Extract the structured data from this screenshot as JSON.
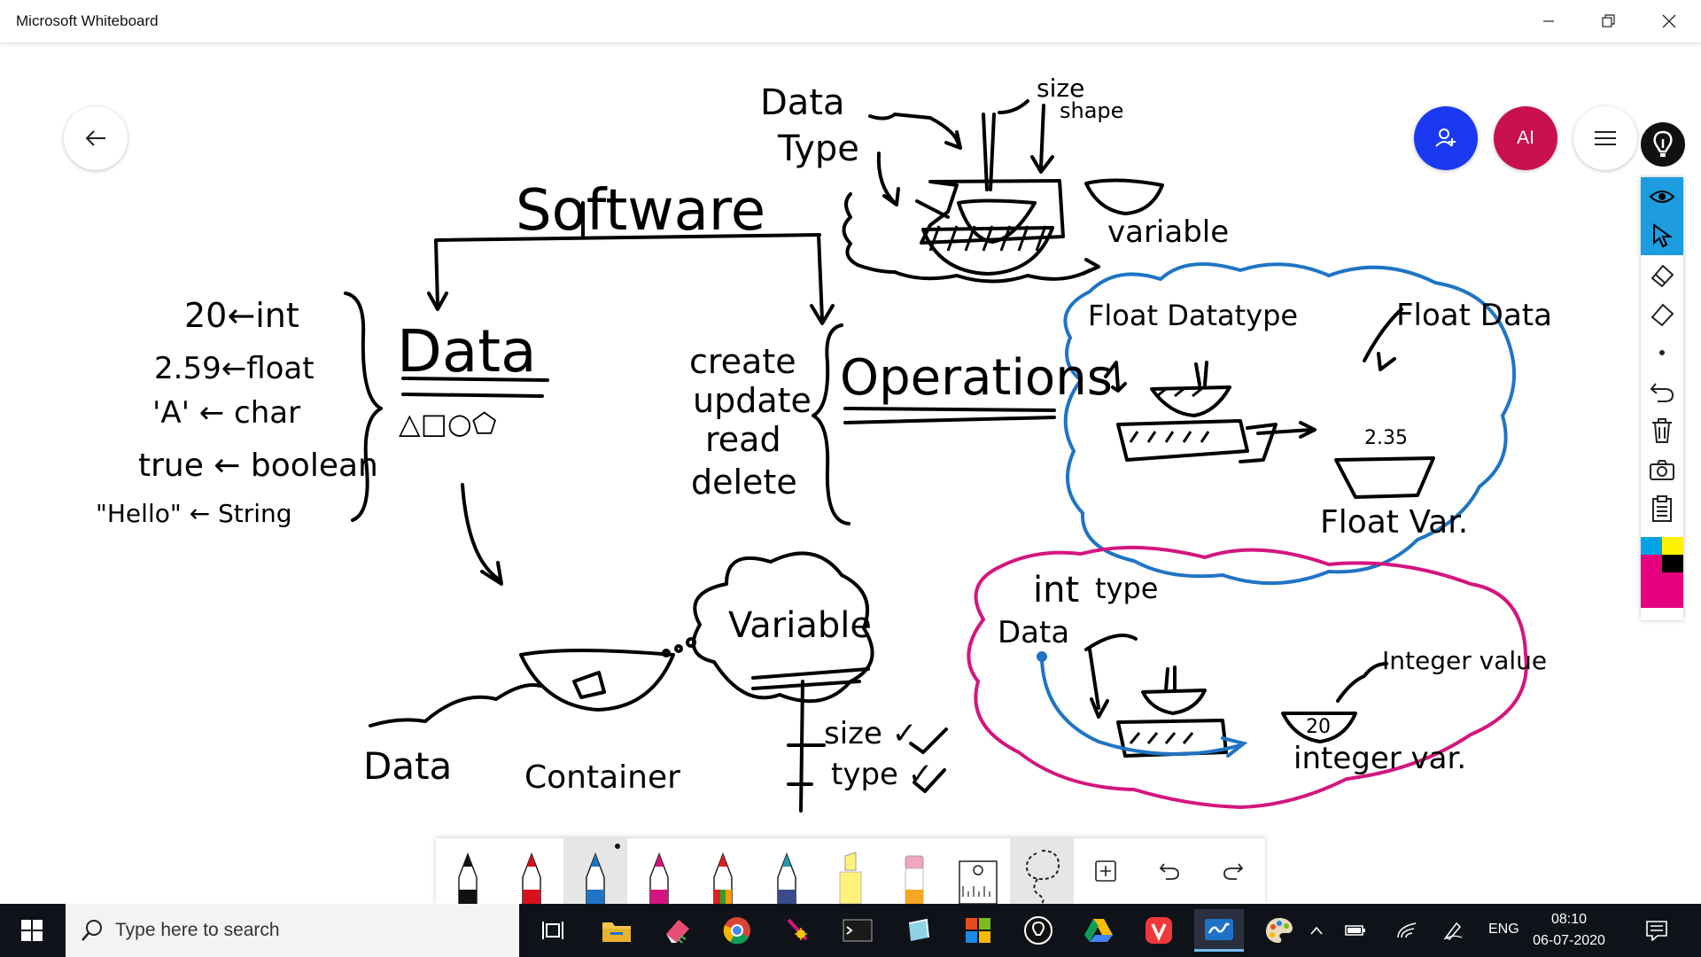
{
  "window": {
    "title": "Microsoft Whiteboard"
  },
  "header": {
    "avatar_initials": "AI"
  },
  "board": {
    "software": "Software",
    "data_heading": "Data",
    "data_shapes": "△□○⬠",
    "ops_heading": "Operations",
    "crud": [
      "create",
      "update",
      "read",
      "delete"
    ],
    "examples": [
      "20←int",
      "2.59←float",
      "'A' ← char",
      "true ← boolean",
      "\"Hello\" ← String"
    ],
    "dt_data": "Data",
    "dt_type": "Type",
    "size_word": "size",
    "shape_word": "shape",
    "variable_word": "variable",
    "float_datatype": "Float Datatype",
    "float_data": "Float Data",
    "float_value": "2.35",
    "float_var": "Float Var.",
    "int_word": "int",
    "type_word": "type",
    "int_data_word": "Data",
    "integer_value": "Integer value",
    "int_value": "20",
    "integer_var": "integer var.",
    "variable_cloud": "Variable",
    "var_size": "size ✓",
    "var_type": "type ✓",
    "data_word": "Data",
    "container_word": "Container"
  },
  "taskbar": {
    "search_placeholder": "Type here to search",
    "lang": "ENG",
    "time": "08:10",
    "date": "06-07-2020"
  },
  "colors": {
    "ink": "#000000",
    "blue_cloud": "#1f74c4",
    "pink_cloud": "#d4157f",
    "accent_blue": "#1a39f0",
    "avatar": "#c8104f",
    "taskbar": "#0f1319"
  }
}
